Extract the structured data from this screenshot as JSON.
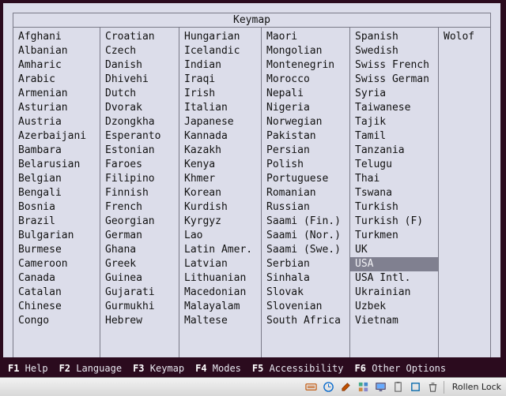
{
  "window": {
    "title": "Keymap"
  },
  "selected": "USA",
  "columns": [
    [
      "Afghani",
      "Albanian",
      "Amharic",
      "Arabic",
      "Armenian",
      "Asturian",
      "Austria",
      "Azerbaijani",
      "Bambara",
      "Belarusian",
      "Belgian",
      "Bengali",
      "Bosnia",
      "Brazil",
      "Bulgarian",
      "Burmese",
      "Cameroon",
      "Canada",
      "Catalan",
      "Chinese",
      "Congo"
    ],
    [
      "Croatian",
      "Czech",
      "Danish",
      "Dhivehi",
      "Dutch",
      "Dvorak",
      "Dzongkha",
      "Esperanto",
      "Estonian",
      "Faroes",
      "Filipino",
      "Finnish",
      "French",
      "Georgian",
      "German",
      "Ghana",
      "Greek",
      "Guinea",
      "Gujarati",
      "Gurmukhi",
      "Hebrew"
    ],
    [
      "Hungarian",
      "Icelandic",
      "Indian",
      "Iraqi",
      "Irish",
      "Italian",
      "Japanese",
      "Kannada",
      "Kazakh",
      "Kenya",
      "Khmer",
      "Korean",
      "Kurdish",
      "Kyrgyz",
      "Lao",
      "Latin Amer.",
      "Latvian",
      "Lithuanian",
      "Macedonian",
      "Malayalam",
      "Maltese"
    ],
    [
      "Maori",
      "Mongolian",
      "Montenegrin",
      "Morocco",
      "Nepali",
      "Nigeria",
      "Norwegian",
      "Pakistan",
      "Persian",
      "Polish",
      "Portuguese",
      "Romanian",
      "Russian",
      "Saami (Fin.)",
      "Saami (Nor.)",
      "Saami (Swe.)",
      "Serbian",
      "Sinhala",
      "Slovak",
      "Slovenian",
      "South Africa"
    ],
    [
      "Spanish",
      "Swedish",
      "Swiss French",
      "Swiss German",
      "Syria",
      "Taiwanese",
      "Tajik",
      "Tamil",
      "Tanzania",
      "Telugu",
      "Thai",
      "Tswana",
      "Turkish",
      "Turkish (F)",
      "Turkmen",
      "UK",
      "USA",
      "USA Intl.",
      "Ukrainian",
      "Uzbek",
      "Vietnam"
    ],
    [
      "Wolof"
    ]
  ],
  "fkeys": [
    {
      "key": "F1",
      "label": "Help"
    },
    {
      "key": "F2",
      "label": "Language"
    },
    {
      "key": "F3",
      "label": "Keymap"
    },
    {
      "key": "F4",
      "label": "Modes"
    },
    {
      "key": "F5",
      "label": "Accessibility"
    },
    {
      "key": "F6",
      "label": "Other Options"
    }
  ],
  "taskbar": {
    "icons": [
      "keyboard-icon",
      "clock-icon",
      "pencil-icon",
      "windows-icon",
      "monitor-icon",
      "clipboard-icon",
      "box-icon",
      "trash-icon"
    ],
    "label": "Rollen Lock"
  }
}
